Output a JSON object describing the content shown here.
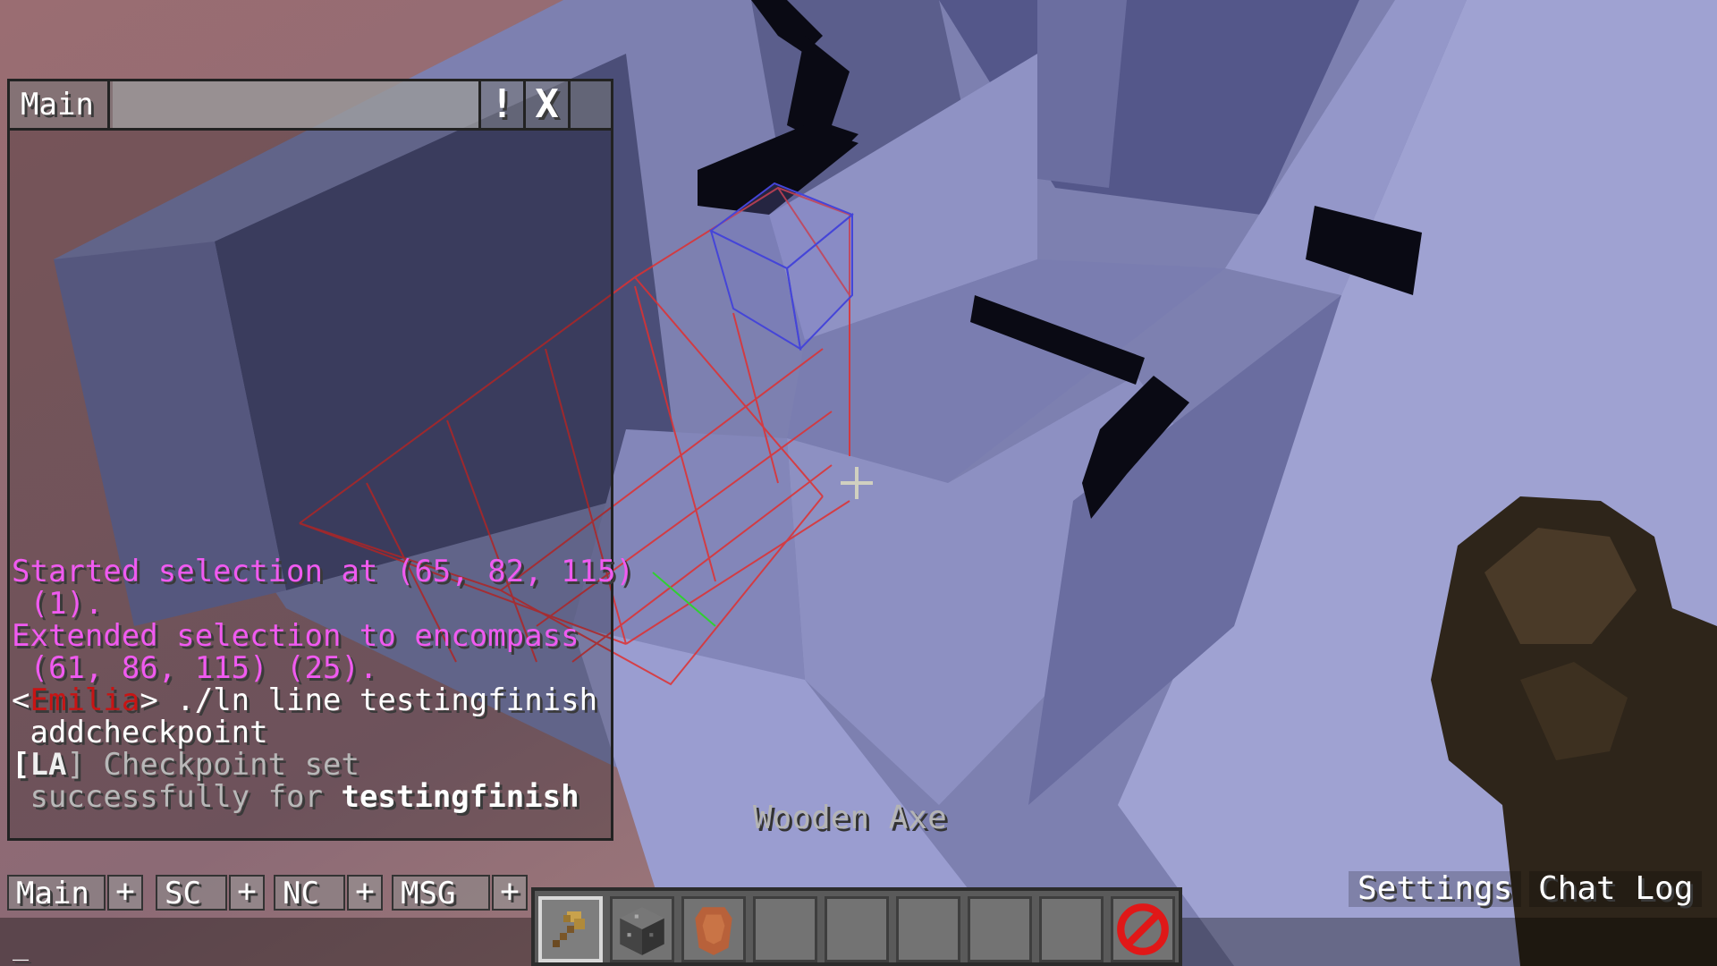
{
  "chat_window": {
    "tab_label": "Main",
    "alert_button": "!",
    "close_button": "X"
  },
  "chat_messages": [
    {
      "text": "Started selection at (65, 82, 115)",
      "color": "#f05af0"
    },
    {
      "text": " (1).",
      "color": "#f05af0"
    },
    {
      "text": "Extended selection to encompass",
      "color": "#f05af0"
    },
    {
      "text": " (61, 86, 115) (25).",
      "color": "#f05af0"
    },
    {
      "prefix_open": "<",
      "player": "Emilia",
      "prefix_close": ">",
      "text": " ./ln line testingfinish",
      "player_color": "#c81414"
    },
    {
      "text": " addcheckpoint",
      "color": "#ffffff"
    },
    {
      "tag_open": "[",
      "tag": "LA",
      "tag_close": "]",
      "text": " Checkpoint set",
      "color": "#b8b8b8"
    },
    {
      "text": " successfully for ",
      "bold_text": "testingfinish",
      "color": "#b8b8b8"
    }
  ],
  "chat_tabs": [
    {
      "label": "Main",
      "plus": "+"
    },
    {
      "label": "SC",
      "plus": "+"
    },
    {
      "label": "NC",
      "plus": "+"
    },
    {
      "label": "MSG",
      "plus": "+"
    }
  ],
  "input": {
    "cursor": "_"
  },
  "held_item_name": "Wooden Axe",
  "buttons": {
    "settings": "Settings",
    "chat_log": "Chat Log"
  },
  "hotbar": {
    "selected_slot": 0,
    "slots": [
      "wooden-axe-icon",
      "bedrock-block-icon",
      "leather-icon",
      "",
      "",
      "",
      "",
      "",
      "barrier-icon"
    ]
  },
  "colors": {
    "selection_outline": "#e03030",
    "corner_outline": "#4040d0",
    "blocks": "#8f93c8",
    "sky": "#8a6a78"
  }
}
